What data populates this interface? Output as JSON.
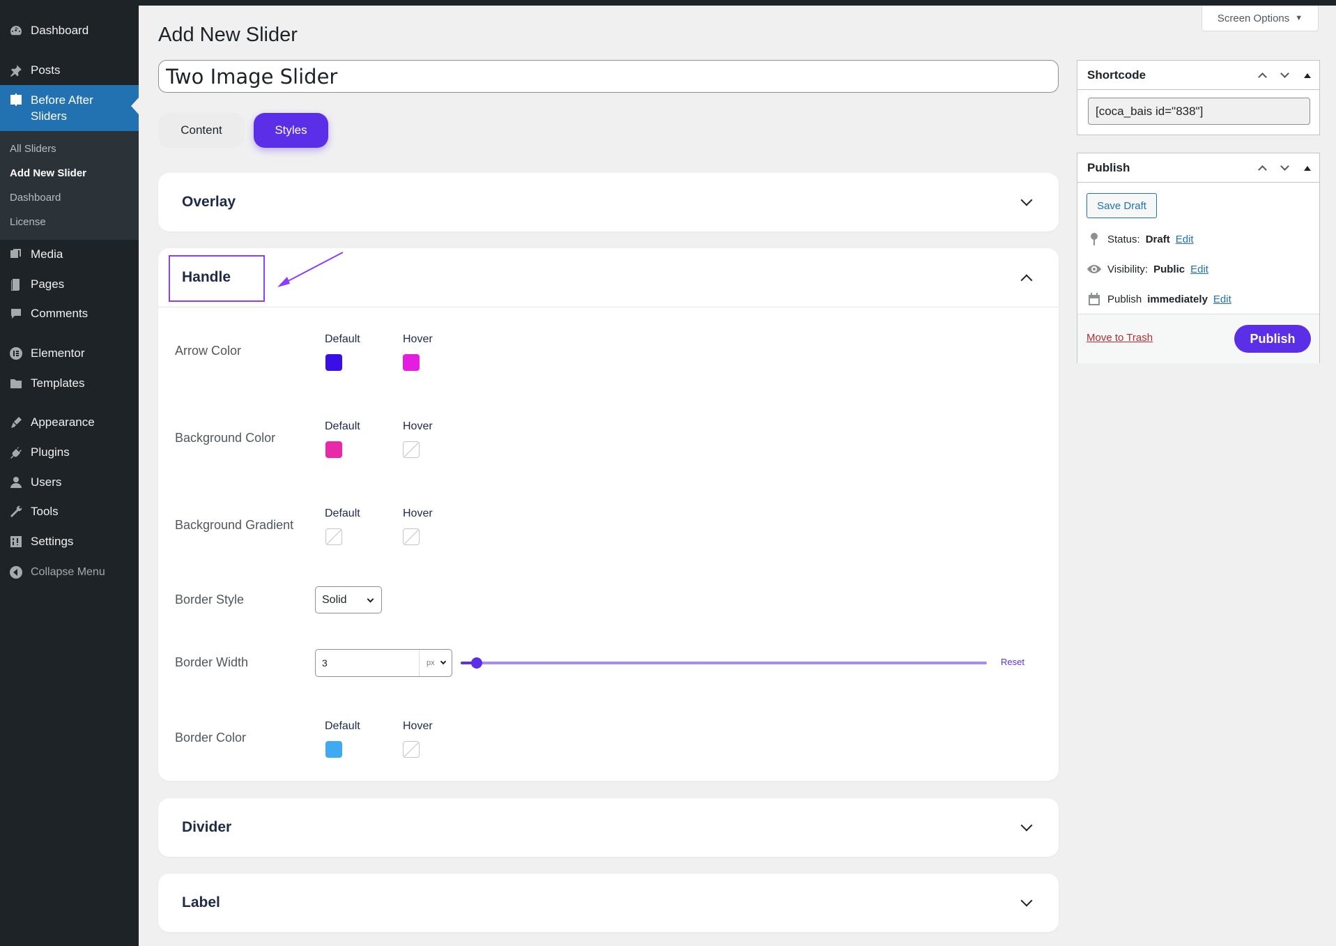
{
  "sidebar": {
    "items": [
      {
        "label": "Dashboard",
        "icon": "dashboard-icon"
      },
      {
        "label": "Posts",
        "icon": "pin-icon"
      },
      {
        "label": "Before After Sliders",
        "line1": "Before After",
        "line2": "Sliders",
        "icon": "compare-icon"
      },
      {
        "label": "Media",
        "icon": "media-icon"
      },
      {
        "label": "Pages",
        "icon": "page-icon"
      },
      {
        "label": "Comments",
        "icon": "comment-icon"
      },
      {
        "label": "Elementor",
        "icon": "elementor-icon"
      },
      {
        "label": "Templates",
        "icon": "folder-icon"
      },
      {
        "label": "Appearance",
        "icon": "brush-icon"
      },
      {
        "label": "Plugins",
        "icon": "plug-icon"
      },
      {
        "label": "Users",
        "icon": "user-icon"
      },
      {
        "label": "Tools",
        "icon": "wrench-icon"
      },
      {
        "label": "Settings",
        "icon": "settings-icon"
      },
      {
        "label": "Collapse Menu",
        "icon": "collapse-icon"
      }
    ],
    "submenu": [
      "All Sliders",
      "Add New Slider",
      "Dashboard",
      "License"
    ]
  },
  "header": {
    "title": "Add New Slider",
    "screen_options": "Screen Options"
  },
  "editor": {
    "slider_title": "Two Image Slider",
    "tabs": [
      {
        "label": "Content",
        "active": false
      },
      {
        "label": "Styles",
        "active": true
      }
    ]
  },
  "sections": {
    "overlay": "Overlay",
    "handle": "Handle",
    "divider": "Divider",
    "label": "Label"
  },
  "handle": {
    "default_label": "Default",
    "hover_label": "Hover",
    "rows": [
      {
        "label": "Arrow Color",
        "default": "#3a0ee6",
        "hover": "#e31ee0"
      },
      {
        "label": "Background Color",
        "default": "#e82aa8",
        "hover": null
      },
      {
        "label": "Background Gradient",
        "default": null,
        "hover": null
      },
      {
        "label": "Border Color",
        "default": "#3fa9f2",
        "hover": null
      }
    ],
    "border_style": {
      "label": "Border Style",
      "value": "Solid"
    },
    "border_width": {
      "label": "Border Width",
      "value": "3",
      "unit": "px",
      "slider_fraction": 0.03,
      "reset": "Reset"
    }
  },
  "shortcode": {
    "title": "Shortcode",
    "value": "[coca_bais id=\"838\"]"
  },
  "publish": {
    "title": "Publish",
    "save_draft": "Save Draft",
    "status_label": "Status:",
    "status_value": "Draft",
    "visibility_label": "Visibility:",
    "visibility_value": "Public",
    "publish_label": "Publish",
    "publish_value": "immediately",
    "edit": "Edit",
    "trash": "Move to Trash",
    "button": "Publish"
  },
  "colors": {
    "accent": "#5b2ee8",
    "admin_sidebar": "#1d2327",
    "admin_highlight": "#2271b1"
  }
}
